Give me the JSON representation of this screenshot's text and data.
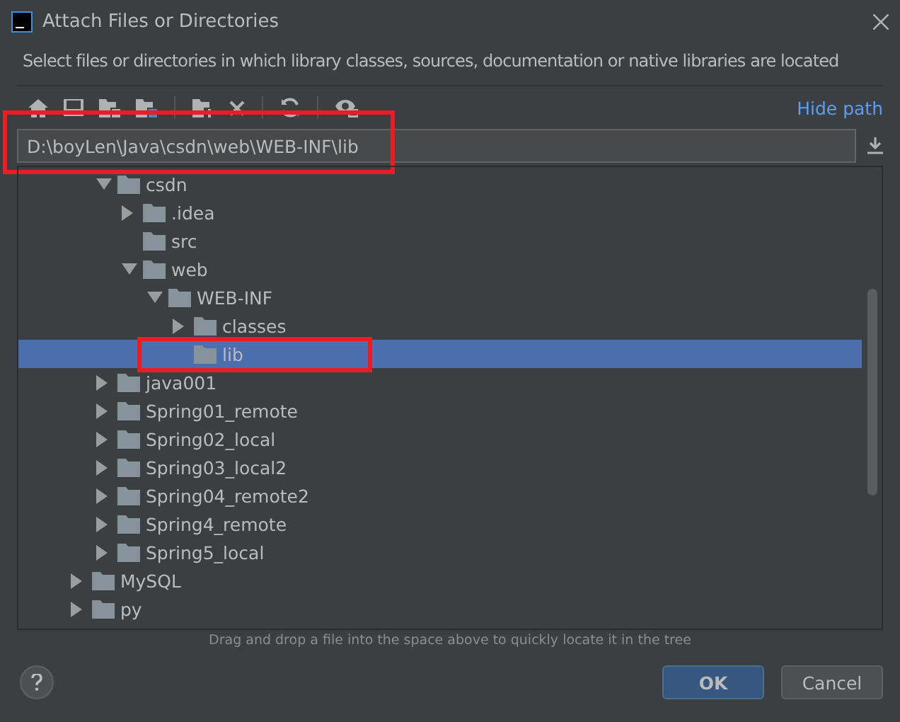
{
  "window": {
    "title": "Attach Files or Directories"
  },
  "description": "Select files or directories in which library classes, sources, documentation or native libraries are located",
  "toolbar": {
    "hide_path_link": "Hide path"
  },
  "path_field": {
    "value": "D:\\boyLen\\Java\\csdn\\web\\WEB-INF\\lib",
    "highlighted": true
  },
  "tree": {
    "items": [
      {
        "children": [
          {
            "name": "csdn",
            "expanded": true,
            "selected": false,
            "children": [
              {
                "name": ".idea",
                "expanded": false,
                "selected": false,
                "highlighted": false
              },
              {
                "name": "src",
                "selected": false,
                "highlighted": false
              },
              {
                "name": "web",
                "expanded": true,
                "selected": false,
                "children": [
                  {
                    "name": "WEB-INF",
                    "expanded": true,
                    "selected": false,
                    "children": [
                      {
                        "name": "classes",
                        "expanded": false,
                        "selected": false,
                        "highlighted": false
                      },
                      {
                        "name": "lib",
                        "selected": true,
                        "highlighted": true
                      }
                    ]
                  }
                ]
              }
            ]
          },
          {
            "name": "java001",
            "expanded": false,
            "selected": false,
            "highlighted": false
          },
          {
            "name": "Spring01_remote",
            "expanded": false,
            "selected": false,
            "highlighted": false
          },
          {
            "name": "Spring02_local",
            "expanded": false,
            "selected": false,
            "highlighted": false
          },
          {
            "name": "Spring03_local2",
            "expanded": false,
            "selected": false,
            "highlighted": false
          },
          {
            "name": "Spring04_remote2",
            "expanded": false,
            "selected": false,
            "highlighted": false
          },
          {
            "name": "Spring4_remote",
            "expanded": false,
            "selected": false,
            "highlighted": false
          },
          {
            "name": "Spring5_local",
            "expanded": false,
            "selected": false,
            "highlighted": false
          }
        ]
      },
      {
        "name": "MySQL",
        "expanded": false,
        "selected": false,
        "highlighted": false
      },
      {
        "name": "py",
        "expanded": false,
        "selected": false,
        "highlighted": false
      }
    ]
  },
  "hint": "Drag and drop a file into the space above to quickly locate it in the tree",
  "buttons": [
    {
      "label": "OK",
      "kind": "primary"
    },
    {
      "label": "Cancel",
      "kind": "secondary"
    }
  ]
}
